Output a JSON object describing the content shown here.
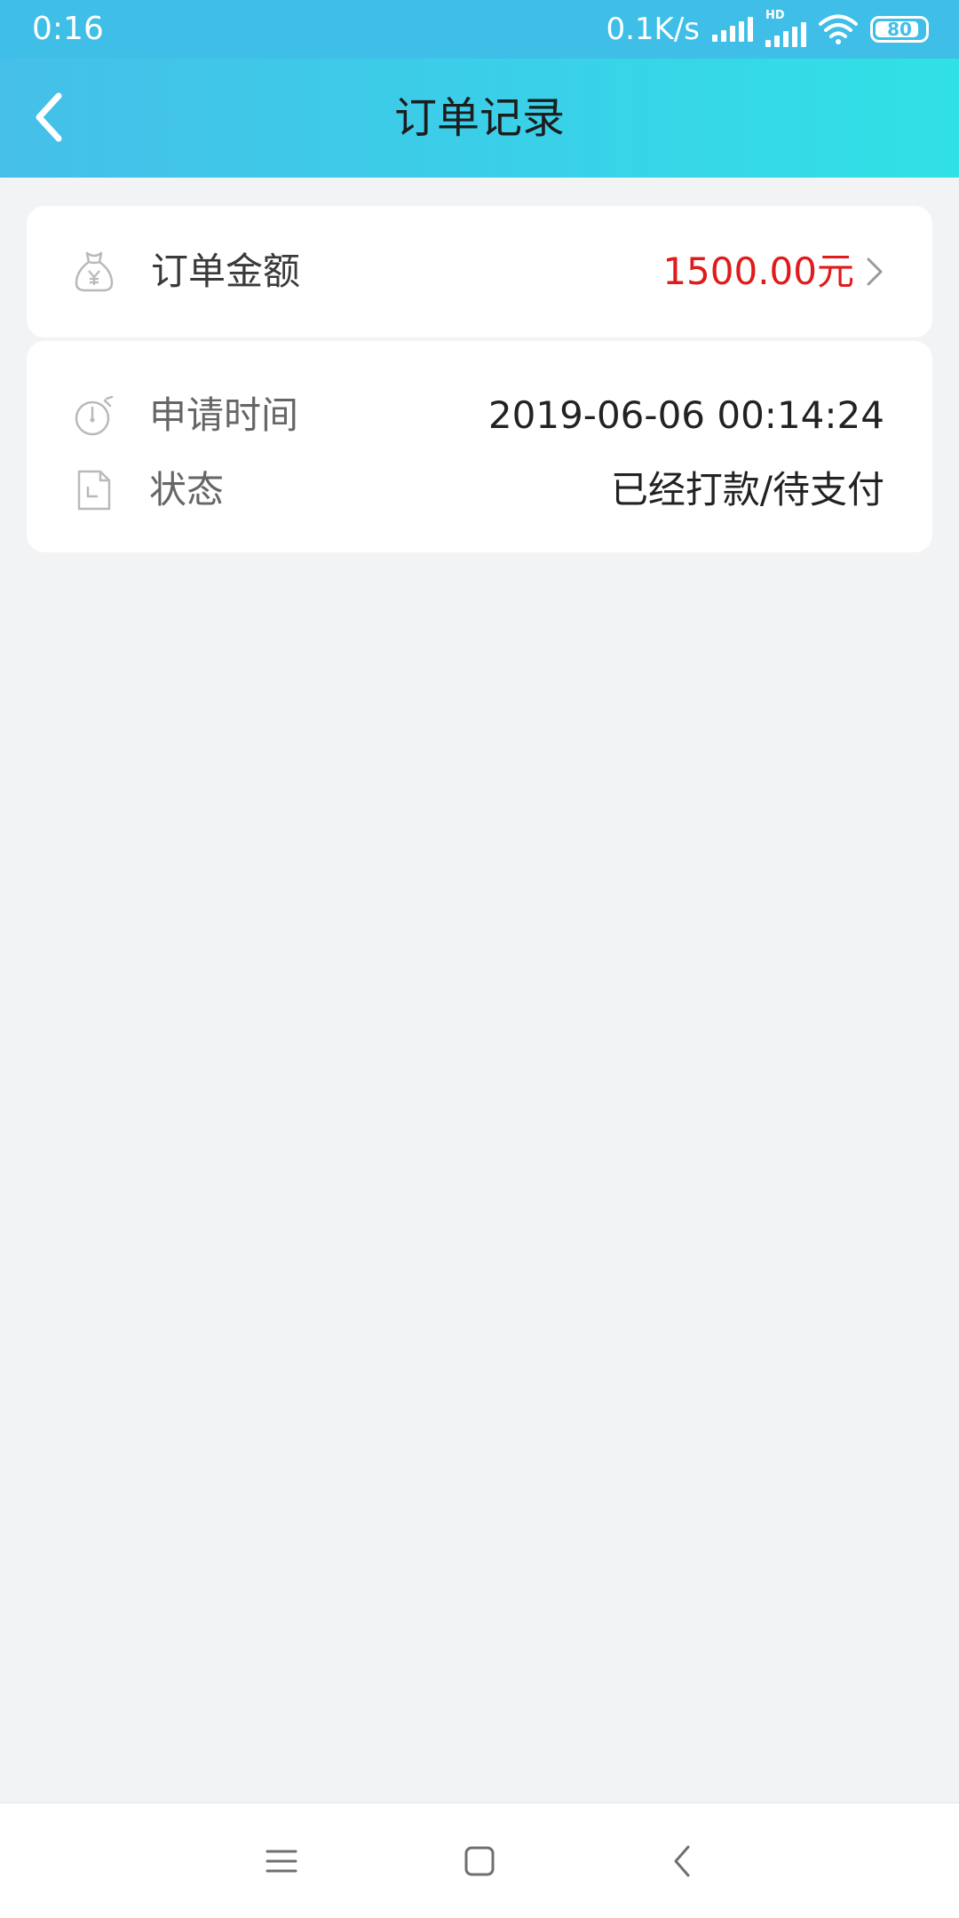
{
  "status_bar": {
    "time": "0:16",
    "net_speed": "0.1K/s",
    "hd_label": "HD",
    "battery_level": "80"
  },
  "header": {
    "title": "订单记录",
    "back_icon": "back-chevron-icon"
  },
  "order_amount": {
    "label": "订单金额",
    "value": "1500.00元",
    "value_color": "#e01b1b",
    "icon": "money-bag-icon"
  },
  "details": [
    {
      "label": "申请时间",
      "value": "2019-06-06 00:14:24",
      "icon": "stopwatch-icon"
    },
    {
      "label": "状态",
      "value": "已经打款/待支付",
      "icon": "document-icon"
    }
  ],
  "colors": {
    "header_gradient_start": "#45bfe9",
    "header_gradient_end": "#30e1e6",
    "background": "#f2f3f5"
  }
}
